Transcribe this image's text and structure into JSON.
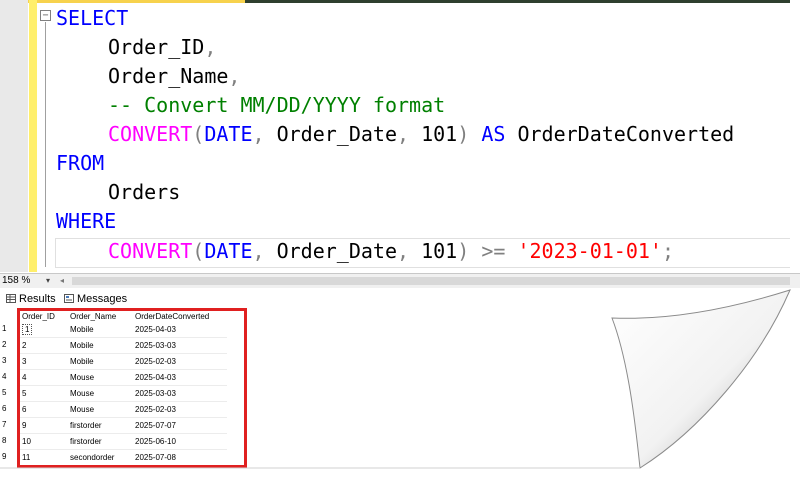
{
  "editor": {
    "collapse_glyph": "−",
    "lines": {
      "l1": {
        "select": "SELECT"
      },
      "l2": {
        "col": "Order_ID",
        "comma": ","
      },
      "l3": {
        "col": "Order_Name",
        "comma": ","
      },
      "l4": {
        "comment": "-- Convert MM/DD/YYYY format"
      },
      "l5": {
        "fn": "CONVERT",
        "lparen": "(",
        "type": "DATE",
        "c1": ",",
        "arg": " Order_Date",
        "c2": ",",
        "num": " 101",
        "rparen": ")",
        "as": " AS",
        "alias": " OrderDateConverted"
      },
      "l6": {
        "from": "FROM"
      },
      "l7": {
        "table": "Orders"
      },
      "l8": {
        "where": "WHERE"
      },
      "l9": {
        "fn": "CONVERT",
        "lparen": "(",
        "type": "DATE",
        "c1": ",",
        "arg": " Order_Date",
        "c2": ",",
        "num": " 101",
        "rparen": ")",
        "op": " >=",
        "str": " '2023-01-01'",
        "semi": ";"
      }
    }
  },
  "statusbar": {
    "zoom": "158 %",
    "zoom_dropdown": "▾",
    "scroll_left": "◂"
  },
  "tabs": {
    "results": "Results",
    "messages": "Messages"
  },
  "grid": {
    "headers": [
      "Order_ID",
      "Order_Name",
      "OrderDateConverted"
    ],
    "rows": [
      {
        "n": "1",
        "id": "1",
        "name": "Mobile",
        "date": "2025-04-03"
      },
      {
        "n": "2",
        "id": "2",
        "name": "Mobile",
        "date": "2025-03-03"
      },
      {
        "n": "3",
        "id": "3",
        "name": "Mobile",
        "date": "2025-02-03"
      },
      {
        "n": "4",
        "id": "4",
        "name": "Mouse",
        "date": "2025-04-03"
      },
      {
        "n": "5",
        "id": "5",
        "name": "Mouse",
        "date": "2025-03-03"
      },
      {
        "n": "6",
        "id": "6",
        "name": "Mouse",
        "date": "2025-02-03"
      },
      {
        "n": "7",
        "id": "9",
        "name": "firstorder",
        "date": "2025-07-07"
      },
      {
        "n": "8",
        "id": "10",
        "name": "firstorder",
        "date": "2025-06-10"
      },
      {
        "n": "9",
        "id": "11",
        "name": "secondorder",
        "date": "2025-07-08"
      }
    ]
  },
  "colors": {
    "keyword": "#0000ff",
    "function": "#ff00ff",
    "string": "#ff0000",
    "comment": "#008000",
    "highlight_box": "#e02020"
  },
  "icons": {
    "results_tab": "grid-icon",
    "messages_tab": "messages-icon"
  }
}
